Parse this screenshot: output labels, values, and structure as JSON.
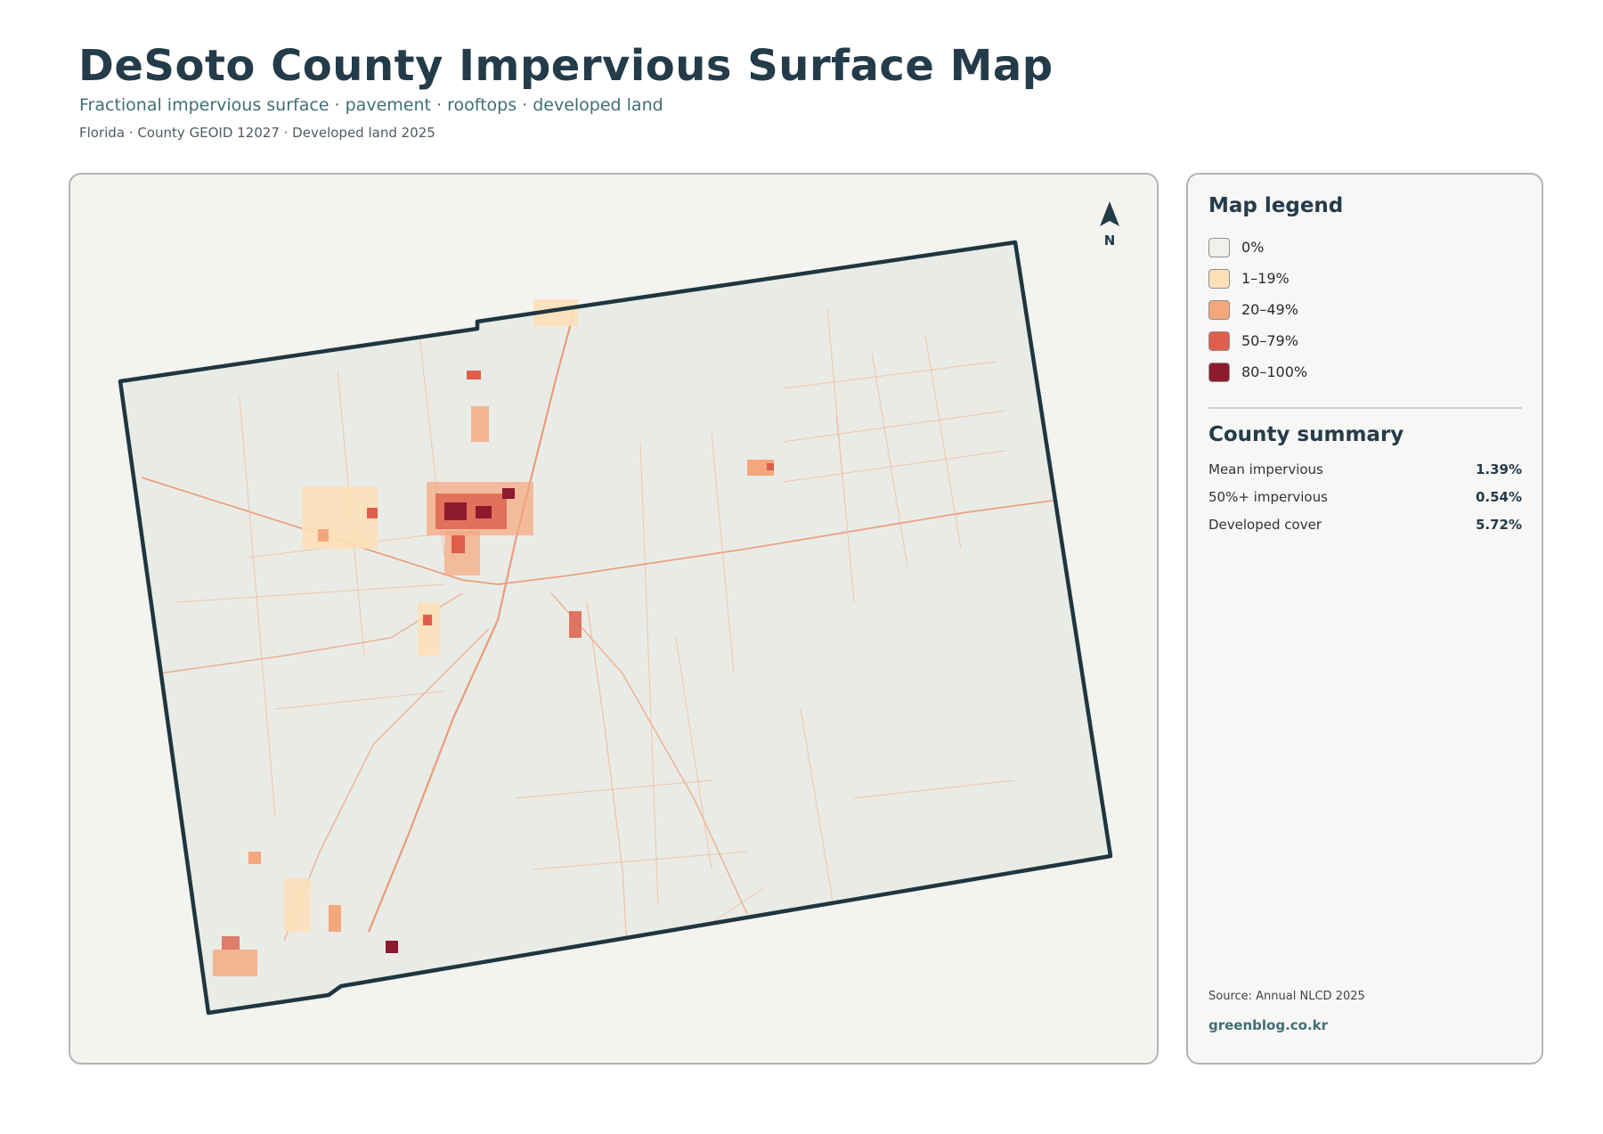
{
  "header": {
    "title": "DeSoto County Impervious Surface Map",
    "subtitle": "Fractional impervious surface · pavement · rooftops · developed land",
    "meta": "Florida · County GEOID 12027 · Developed land 2025"
  },
  "map": {
    "north_label": "N",
    "colors": {
      "county_fill": "#e9ece6",
      "county_outline": "#1f3640",
      "road": "#e98f68"
    }
  },
  "legend": {
    "title": "Map legend",
    "items": [
      {
        "label": "0%",
        "color": "#f0f0ec"
      },
      {
        "label": "1–19%",
        "color": "#fde0b8"
      },
      {
        "label": "20–49%",
        "color": "#f4a67c"
      },
      {
        "label": "50–79%",
        "color": "#de5f4b"
      },
      {
        "label": "80–100%",
        "color": "#8e1a2e"
      }
    ]
  },
  "summary": {
    "title": "County summary",
    "stats": [
      {
        "label": "Mean impervious",
        "value": "1.39%"
      },
      {
        "label": "50%+ impervious",
        "value": "0.54%"
      },
      {
        "label": "Developed cover",
        "value": "5.72%"
      }
    ]
  },
  "footer": {
    "source": "Source: Annual NLCD 2025",
    "site": "greenblog.co.kr"
  }
}
